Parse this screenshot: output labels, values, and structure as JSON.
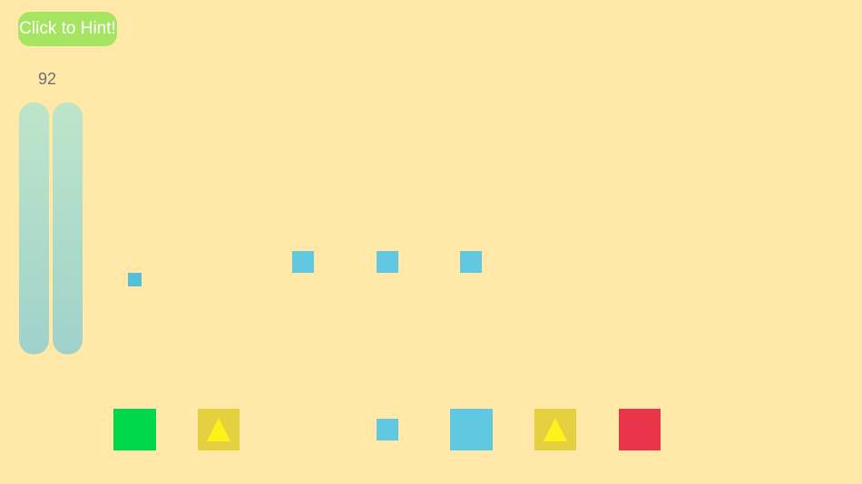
{
  "hint_button": {
    "label": "Click to Hint!"
  },
  "counter": {
    "value": "92"
  },
  "colors": {
    "background": "#ffe8a8",
    "hint_button": "#a6e562",
    "blue_tile": "#60c9e1",
    "green_tile": "#00d84b",
    "yellow_tile": "#e5d13f",
    "triangle": "#fff21a",
    "red_tile": "#ea3449"
  },
  "tray": {
    "items": [
      {
        "color": "green"
      },
      {
        "color": "yellow",
        "icon": "triangle-icon"
      },
      {
        "color": "blue"
      },
      {
        "color": "blue"
      },
      {
        "color": "yellow",
        "icon": "triangle-icon"
      },
      {
        "color": "red"
      }
    ]
  }
}
